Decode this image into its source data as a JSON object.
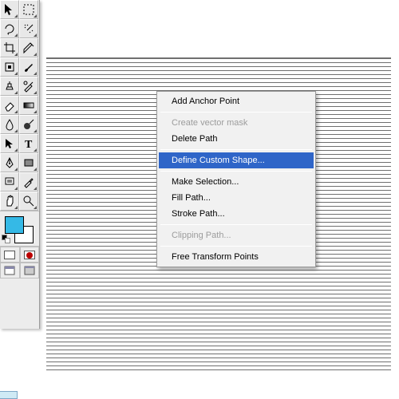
{
  "toolbox": {
    "tools": [
      {
        "name": "move-tool"
      },
      {
        "name": "rect-marquee-tool"
      },
      {
        "name": "lasso-tool"
      },
      {
        "name": "magic-wand-tool"
      },
      {
        "name": "crop-tool"
      },
      {
        "name": "slice-tool"
      },
      {
        "name": "healing-brush-tool"
      },
      {
        "name": "brush-tool"
      },
      {
        "name": "clone-stamp-tool"
      },
      {
        "name": "history-brush-tool"
      },
      {
        "name": "eraser-tool"
      },
      {
        "name": "gradient-tool"
      },
      {
        "name": "blur-tool"
      },
      {
        "name": "dodge-tool"
      },
      {
        "name": "path-selection-tool"
      },
      {
        "name": "type-tool"
      },
      {
        "name": "pen-tool"
      },
      {
        "name": "rect-shape-tool"
      },
      {
        "name": "notes-tool"
      },
      {
        "name": "eyedropper-tool"
      },
      {
        "name": "hand-tool"
      },
      {
        "name": "zoom-tool"
      }
    ],
    "foreground_color": "#35b9e6",
    "background_color": "#ffffff"
  },
  "context_menu": {
    "items": [
      {
        "label": "Add Anchor Point",
        "enabled": true,
        "highlight": false
      },
      "sep",
      {
        "label": "Create vector mask",
        "enabled": false,
        "highlight": false
      },
      {
        "label": "Delete Path",
        "enabled": true,
        "highlight": false
      },
      "sep",
      {
        "label": "Define Custom Shape...",
        "enabled": true,
        "highlight": true
      },
      "sep",
      {
        "label": "Make Selection...",
        "enabled": true,
        "highlight": false
      },
      {
        "label": "Fill Path...",
        "enabled": true,
        "highlight": false
      },
      {
        "label": "Stroke Path...",
        "enabled": true,
        "highlight": false
      },
      "sep",
      {
        "label": "Clipping Path...",
        "enabled": false,
        "highlight": false
      },
      "sep",
      {
        "label": "Free Transform Points",
        "enabled": true,
        "highlight": false
      }
    ]
  }
}
